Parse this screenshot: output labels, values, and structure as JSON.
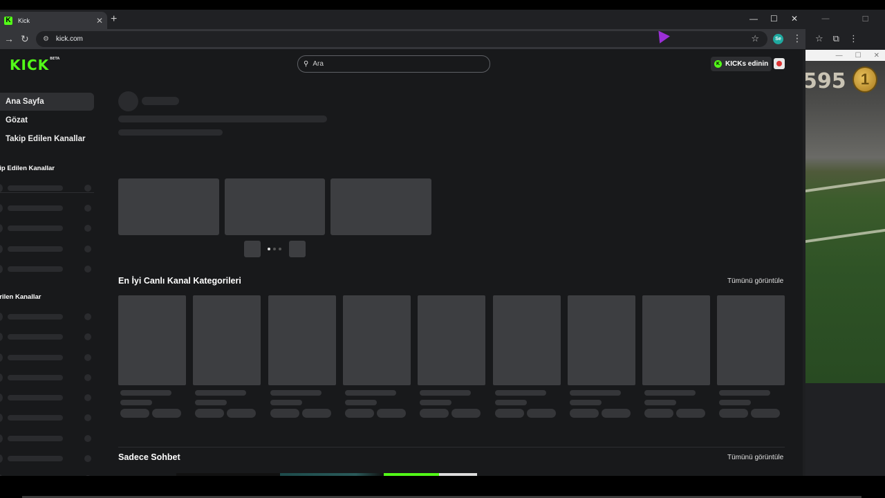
{
  "browser": {
    "tab_title": "Kick",
    "tab_favicon": "K",
    "new_tab": "+",
    "close_tab": "✕",
    "url": "kick.com",
    "profile_initials": "Se",
    "win_minimize": "—",
    "win_maximize": "☐",
    "win_close": "✕",
    "back": "→",
    "reload": "↻",
    "tune": "⚙",
    "star": "☆",
    "menu": "⋮"
  },
  "site": {
    "logo": "KICK",
    "logo_badge": "BETA",
    "brand_color": "#53fc18",
    "search_placeholder": "Ara",
    "kicks_button": "KICKs edinin"
  },
  "sidebar": {
    "items": [
      {
        "label": "Ana Sayfa",
        "active": true
      },
      {
        "label": "Gözat",
        "active": false
      },
      {
        "label": "Takip Edilen Kanallar",
        "active": false
      }
    ],
    "section_followed": "kip Edilen Kanallar",
    "section_recommended": "erilen Kanallar"
  },
  "main": {
    "top_categories_title": "En İyi Canlı Kanal Kategorileri",
    "top_categories_see_all": "Tümünü görüntüle",
    "chat_only_title": "Sadece Sohbet",
    "chat_only_see_all": "Tümünü görüntüle"
  },
  "background_window": {
    "score": "595",
    "coin": "1"
  }
}
